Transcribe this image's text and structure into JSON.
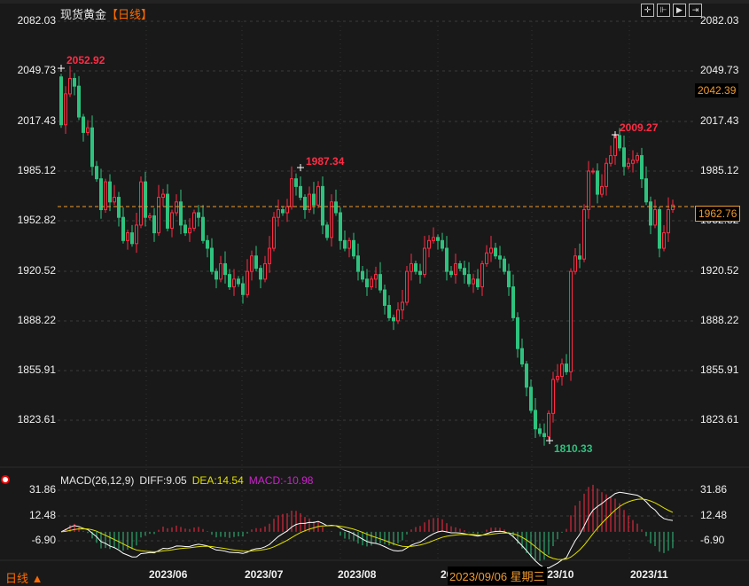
{
  "header": {
    "instrument": "现货黄金",
    "period": "【日线】"
  },
  "toolbar": [
    {
      "icon": "crosshair-icon",
      "glyph": "✛"
    },
    {
      "icon": "fit-axis-icon",
      "glyph": "⊩"
    },
    {
      "icon": "play-icon",
      "glyph": "▶"
    },
    {
      "icon": "move-right-icon",
      "glyph": "⇥"
    }
  ],
  "colors": {
    "up": "#ff2b45",
    "down": "#2ec27e",
    "diff": "#ffffff",
    "dea": "#e0e000",
    "macd": "#d020d0",
    "crosshair": "#f09a30",
    "period": "#ff6a00"
  },
  "price_axis": {
    "ticks": [
      "2082.03",
      "2049.73",
      "2017.43",
      "1985.12",
      "1952.82",
      "1920.52",
      "1888.22",
      "1855.91",
      "1823.61"
    ]
  },
  "prev_close_label": "2042.39",
  "current_price_label": "1962.76",
  "annotations": {
    "high1": "2052.92",
    "high2": "1987.34",
    "high3": "2009.27",
    "low1": "1810.33"
  },
  "macd": {
    "title": "MACD(26,12,9)",
    "diff": "DIFF:9.05",
    "dea": "DEA:14.54",
    "macd": "MACD:-10.98",
    "ticks": [
      "31.86",
      "12.48",
      "-6.90"
    ]
  },
  "x_axis": {
    "labels": [
      "2023/06",
      "2023/07",
      "2023/08",
      "2023/09",
      "2023/10",
      "2023/11"
    ]
  },
  "tooltip_date": "2023/09/06 星期三",
  "period_switch": "日线 ▲",
  "chart_data": {
    "type": "candlestick",
    "title": "现货黄金【日线】",
    "ylim": [
      1823.61,
      2082.03
    ],
    "first_open": 2046,
    "closes": [
      2015,
      2035,
      2045,
      2040,
      2020,
      2010,
      2013,
      1988,
      1980,
      1960,
      1978,
      1965,
      1968,
      1955,
      1940,
      1945,
      1938,
      1950,
      1978,
      1955,
      1956,
      1945,
      1968,
      1970,
      1948,
      1958,
      1965,
      1950,
      1945,
      1948,
      1958,
      1955,
      1940,
      1935,
      1920,
      1915,
      1925,
      1918,
      1910,
      1915,
      1912,
      1905,
      1920,
      1930,
      1922,
      1915,
      1925,
      1935,
      1955,
      1960,
      1958,
      1962,
      1980,
      1975,
      1968,
      1960,
      1970,
      1963,
      1975,
      1950,
      1942,
      1965,
      1958,
      1940,
      1935,
      1940,
      1930,
      1920,
      1915,
      1910,
      1915,
      1918,
      1908,
      1898,
      1890,
      1888,
      1895,
      1900,
      1920,
      1925,
      1920,
      1918,
      1935,
      1940,
      1942,
      1940,
      1935,
      1920,
      1918,
      1925,
      1922,
      1918,
      1912,
      1915,
      1910,
      1925,
      1932,
      1935,
      1930,
      1928,
      1920,
      1910,
      1890,
      1870,
      1860,
      1845,
      1830,
      1818,
      1815,
      1813,
      1828,
      1850,
      1852,
      1860,
      1855,
      1920,
      1930,
      1928,
      1960,
      1985,
      1985,
      1970,
      1975,
      1990,
      1995,
      2008,
      2000,
      1988,
      1990,
      1992,
      1995,
      1980,
      1965,
      1950,
      1960,
      1935,
      1945,
      1960,
      1963
    ],
    "macd_params": [
      26,
      12,
      9
    ],
    "macd_ylim": [
      -6.9,
      31.86
    ]
  }
}
